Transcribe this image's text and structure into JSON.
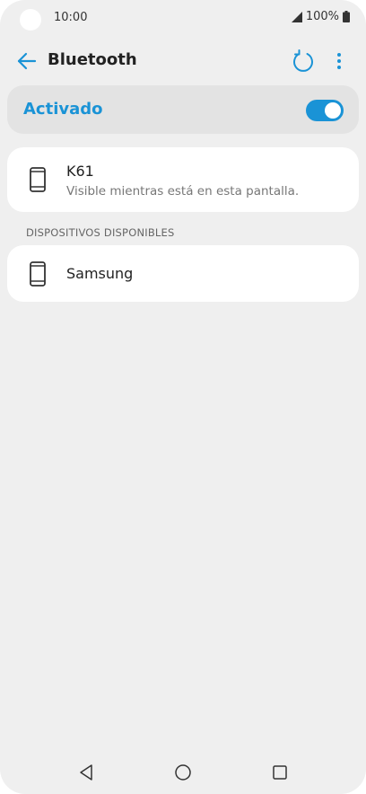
{
  "status_bar": {
    "time": "10:00",
    "battery_text": "100%"
  },
  "app_bar": {
    "title": "Bluetooth",
    "icons": [
      "back-arrow-icon",
      "refresh-icon",
      "more-vert-icon"
    ]
  },
  "toggle": {
    "label": "Activado",
    "state": true
  },
  "this_device": {
    "name": "K61",
    "subtitle": "Visible mientras está en esta pantalla."
  },
  "available": {
    "header": "DISPOSITIVOS DISPONIBLES",
    "devices": [
      {
        "name": "Samsung"
      }
    ]
  },
  "colors": {
    "accent": "#1a93d6",
    "background": "#efefef",
    "card": "#ffffff",
    "toggle_card": "#e3e3e3"
  }
}
